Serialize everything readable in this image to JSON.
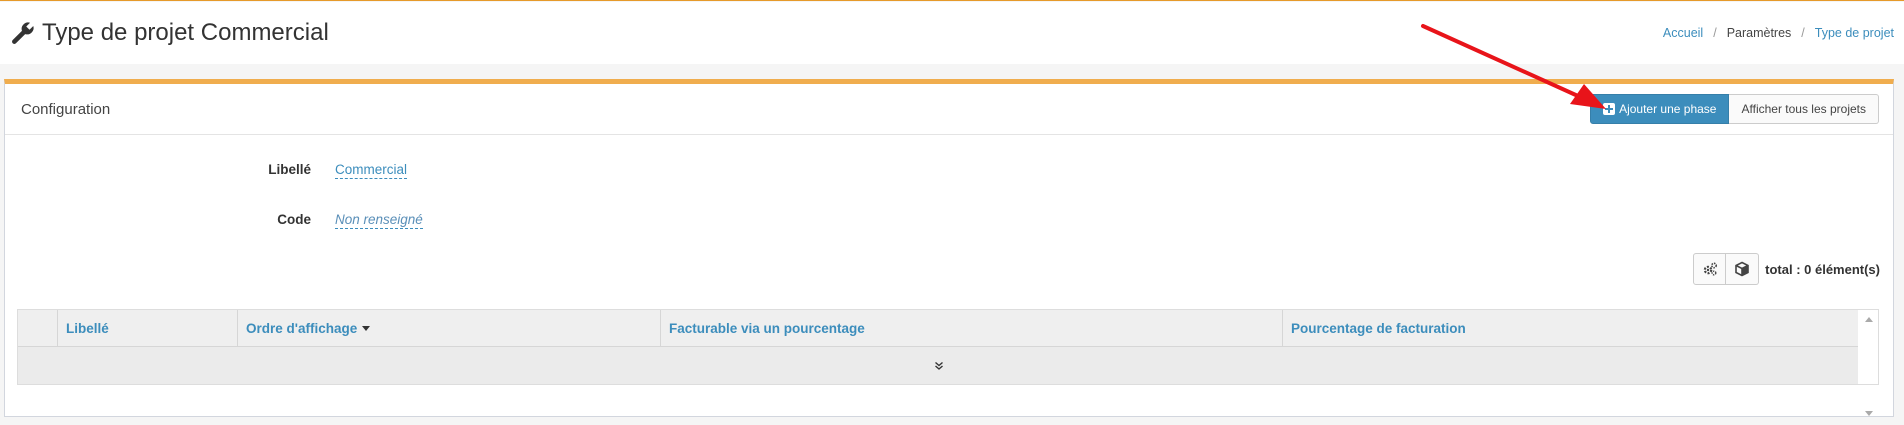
{
  "page": {
    "title": "Type de projet Commercial",
    "title_icon": "wrench-icon"
  },
  "breadcrumb": {
    "items": [
      "Accueil",
      "Paramètres",
      "Type de projet"
    ],
    "separator": "/"
  },
  "box": {
    "title": "Configuration",
    "accent_color": "#f0ad4e",
    "buttons": {
      "add_phase": "Ajouter une phase",
      "show_all": "Afficher tous les projets"
    }
  },
  "fields": [
    {
      "label": "Libellé",
      "value": "Commercial"
    },
    {
      "label": "Code",
      "value": "Non renseigné"
    }
  ],
  "grid": {
    "total_label": "total : 0 élément(s)",
    "tools": [
      "cogs-icon",
      "cube-icon"
    ],
    "columns": [
      "Libellé",
      "Ordre d'affichage",
      "Facturable via un pourcentage",
      "Pourcentage de facturation"
    ],
    "sorted_column": "Ordre d'affichage",
    "expand_icon": "double-chevron-down-icon"
  },
  "colors": {
    "primary": "#3c8dbc",
    "annotation_arrow": "#e8141a"
  }
}
